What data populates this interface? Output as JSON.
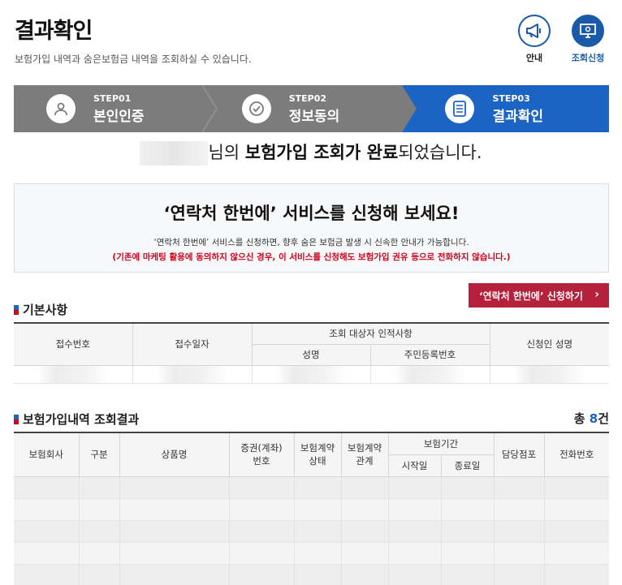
{
  "header": {
    "title": "결과확인",
    "subtitle": "보험가입 내역과 숨은보험금 내역을 조회하실 수 있습니다.",
    "guide_label": "안내",
    "apply_label": "조회신청"
  },
  "steps": [
    {
      "num": "STEP01",
      "name": "본인인증",
      "icon": "person-icon"
    },
    {
      "num": "STEP02",
      "name": "정보동의",
      "icon": "check-icon"
    },
    {
      "num": "STEP03",
      "name": "결과확인",
      "icon": "document-icon"
    }
  ],
  "result": {
    "msg_suffix_1": "님의 ",
    "msg_bold": "보험가입 조회가 완료",
    "msg_suffix_2": "되었습니다."
  },
  "promo": {
    "title": "‘연락처 한번에’ 서비스를 신청해 보세요!",
    "desc": "‘연락처 한번에’ 서비스를 신청하면, 향후 숨은 보험금 발생 시 신속한 안내가 가능합니다.",
    "warning": "(기존에 마케팅 활용에 동의하지 않으신 경우, 이 서비스를 신청해도 보험가입 권유 등으로 전화하지 않습니다.)",
    "button_label": "‘연락처 한번에’ 신청하기",
    "button_arrow": "›"
  },
  "basic": {
    "title": "기본사항",
    "headers": {
      "receipt_no": "접수번호",
      "receipt_date": "접수일자",
      "target_group": "조회 대상자 인적사항",
      "name": "성명",
      "resident_no": "주민등록번호",
      "applicant": "신청인 성명"
    }
  },
  "results": {
    "title": "보험가입내역 조회결과",
    "count_prefix": "총 ",
    "count": "8",
    "count_suffix": "건",
    "headers": {
      "company": "보험회사",
      "type": "구분",
      "product": "상품명",
      "policy_no_1": "증권(계좌)",
      "policy_no_2": "번호",
      "status_1": "보험계약",
      "status_2": "상태",
      "relation_1": "보험계약",
      "relation_2": "관계",
      "period": "보험기간",
      "start": "시작일",
      "end": "종료일",
      "branch": "담당점포",
      "phone": "전화번호"
    }
  },
  "colors": {
    "primary": "#1c64c4",
    "step_gray": "#7c7c7c",
    "red": "#b5203a",
    "warning": "#d0021b"
  }
}
